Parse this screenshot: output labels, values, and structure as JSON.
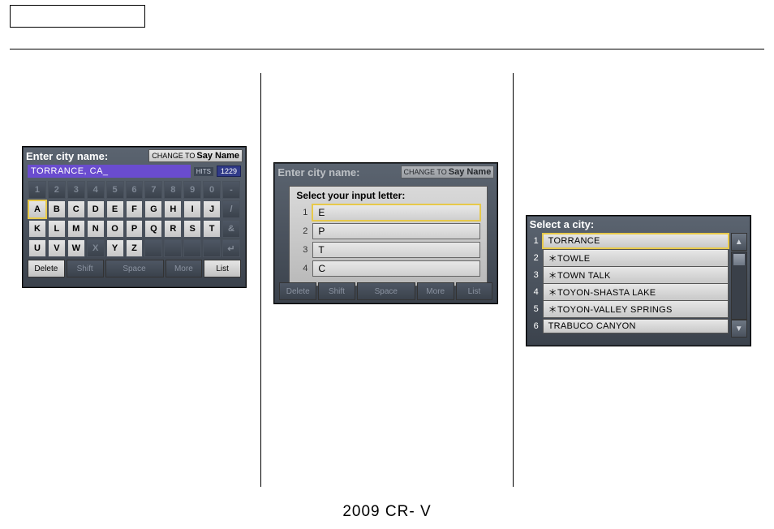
{
  "footer": "2009  CR- V",
  "screen1": {
    "title": "Enter city name:",
    "change_to": "CHANGE TO",
    "say_name": "Say Name",
    "input_value": "TORRANCE, CA_",
    "hits_label": "HITS",
    "hits_count": "1229",
    "row_nums": [
      "1",
      "2",
      "3",
      "4",
      "5",
      "6",
      "7",
      "8",
      "9",
      "0",
      "-"
    ],
    "row_a": [
      "A",
      "B",
      "C",
      "D",
      "E",
      "F",
      "G",
      "H",
      "I",
      "J"
    ],
    "row_a_side": "/",
    "row_k": [
      "K",
      "L",
      "M",
      "N",
      "O",
      "P",
      "Q",
      "R",
      "S",
      "T"
    ],
    "row_k_side": "&",
    "row_u": [
      "U",
      "V",
      "W",
      "X",
      "Y",
      "Z"
    ],
    "row_u_blank": [
      "",
      "",
      "",
      ""
    ],
    "row_u_side": "↵",
    "disabled_letters": [
      "X"
    ],
    "highlight_letter": "A",
    "btn_delete": "Delete",
    "btn_shift": "Shift",
    "btn_space": "Space",
    "btn_more": "More",
    "btn_list": "List"
  },
  "screen2": {
    "title": "Enter city name:",
    "change_to": "CHANGE TO",
    "say_name": "Say Name",
    "overlay_title": "Select your input letter:",
    "options": [
      {
        "n": "1",
        "v": "E",
        "hl": true
      },
      {
        "n": "2",
        "v": "P",
        "hl": false
      },
      {
        "n": "3",
        "v": "T",
        "hl": false
      },
      {
        "n": "4",
        "v": "C",
        "hl": false
      }
    ],
    "btn_delete": "Delete",
    "btn_shift": "Shift",
    "btn_space": "Space",
    "btn_more": "More",
    "btn_list": "List"
  },
  "screen3": {
    "title": "Select a city:",
    "items": [
      {
        "n": "1",
        "v": "  TORRANCE",
        "hl": true
      },
      {
        "n": "2",
        "v": "＊TOWLE",
        "hl": false
      },
      {
        "n": "3",
        "v": "＊TOWN TALK",
        "hl": false
      },
      {
        "n": "4",
        "v": "＊TOYON-SHASTA LAKE",
        "hl": false
      },
      {
        "n": "5",
        "v": "＊TOYON-VALLEY SPRINGS",
        "hl": false
      },
      {
        "n": "6",
        "v": "  TRABUCO CANYON",
        "hl": false
      }
    ],
    "up": "▲",
    "down": "▼"
  }
}
